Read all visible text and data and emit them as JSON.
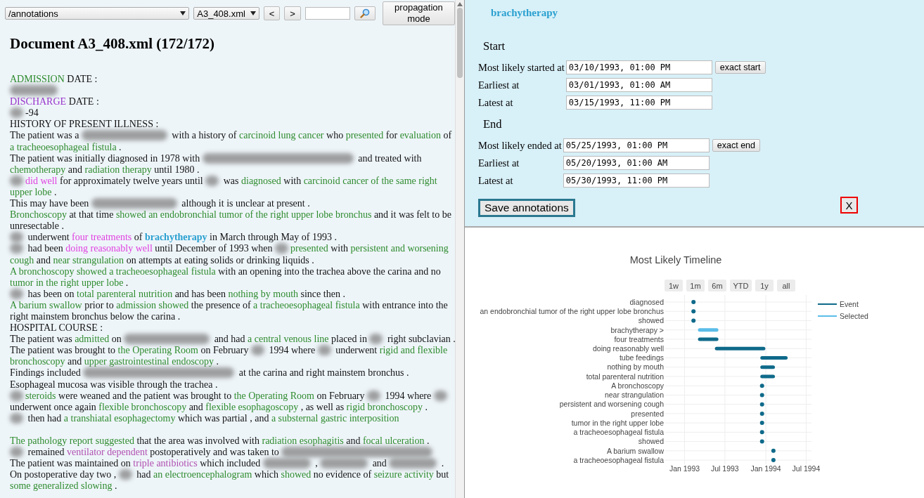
{
  "toolbar": {
    "folder": "/annotations",
    "file": "A3_408.xml",
    "prev": "<",
    "next": ">",
    "propagation": "propagation mode"
  },
  "document": {
    "title": "Document A3_408.xml (172/172)",
    "lines": [
      {
        "kind": "line",
        "segments": [
          {
            "kind": "event",
            "text": "ADMISSION"
          },
          {
            "kind": "plain",
            "text": " DATE :"
          }
        ]
      },
      {
        "kind": "line",
        "segments": [
          {
            "kind": "blurmid"
          }
        ]
      },
      {
        "kind": "line",
        "segments": [
          {
            "kind": "section",
            "text": "DISCHARGE"
          },
          {
            "kind": "plain",
            "text": " DATE :"
          }
        ]
      },
      {
        "kind": "line",
        "segments": [
          {
            "kind": "blurshort"
          },
          {
            "kind": "plain",
            "text": "-94"
          }
        ]
      },
      {
        "kind": "line",
        "segments": [
          {
            "kind": "plain",
            "text": "HISTORY OF PRESENT ILLNESS :"
          }
        ]
      },
      {
        "kind": "line",
        "segments": [
          {
            "kind": "plain",
            "text": "The patient was a "
          },
          {
            "kind": "blurlong"
          },
          {
            "kind": "plain",
            "text": " with a history of "
          },
          {
            "kind": "event",
            "text": "carcinoid lung cancer"
          },
          {
            "kind": "plain",
            "text": " who "
          },
          {
            "kind": "event",
            "text": "presented"
          },
          {
            "kind": "plain",
            "text": " for "
          },
          {
            "kind": "event",
            "text": "evaluation"
          },
          {
            "kind": "plain",
            "text": " of "
          },
          {
            "kind": "event",
            "text": "a tracheoesophageal fistula"
          },
          {
            "kind": "plain",
            "text": " ."
          }
        ]
      },
      {
        "kind": "line",
        "segments": [
          {
            "kind": "plain",
            "text": "The patient was initially diagnosed in 1978 with "
          },
          {
            "kind": "blurwide"
          },
          {
            "kind": "plain",
            "text": " and treated with "
          },
          {
            "kind": "event",
            "text": "chemotherapy"
          },
          {
            "kind": "plain",
            "text": " and "
          },
          {
            "kind": "event",
            "text": "radiation therapy"
          },
          {
            "kind": "plain",
            "text": " until 1980 ."
          }
        ]
      },
      {
        "kind": "line",
        "segments": [
          {
            "kind": "blurshort"
          },
          {
            "kind": "timex",
            "text": "did well"
          },
          {
            "kind": "plain",
            "text": " for approximately twelve years until "
          },
          {
            "kind": "blurshort"
          },
          {
            "kind": "plain",
            "text": " was "
          },
          {
            "kind": "event",
            "text": "diagnosed"
          },
          {
            "kind": "plain",
            "text": " with "
          },
          {
            "kind": "event",
            "text": "carcinoid cancer of the same right upper lobe"
          },
          {
            "kind": "plain",
            "text": " ."
          }
        ]
      },
      {
        "kind": "line",
        "segments": [
          {
            "kind": "plain",
            "text": "This may have been "
          },
          {
            "kind": "blurlong"
          },
          {
            "kind": "plain",
            "text": " although it is unclear at present ."
          }
        ]
      },
      {
        "kind": "line",
        "segments": [
          {
            "kind": "event",
            "text": "Bronchoscopy"
          },
          {
            "kind": "plain",
            "text": " at that time "
          },
          {
            "kind": "event",
            "text": "showed an endobronchial tumor of the right upper lobe bronchus"
          },
          {
            "kind": "plain",
            "text": " and it was felt to be unresectable ."
          }
        ]
      },
      {
        "kind": "line",
        "segments": [
          {
            "kind": "blurshort"
          },
          {
            "kind": "plain",
            "text": " underwent "
          },
          {
            "kind": "timex",
            "text": "four treatments"
          },
          {
            "kind": "plain",
            "text": " of "
          },
          {
            "kind": "selected",
            "text": "brachytherapy"
          },
          {
            "kind": "plain",
            "text": " in March through May of 1993 ."
          }
        ]
      },
      {
        "kind": "line",
        "segments": [
          {
            "kind": "blurshort"
          },
          {
            "kind": "plain",
            "text": " had been "
          },
          {
            "kind": "timex",
            "text": "doing reasonably well"
          },
          {
            "kind": "plain",
            "text": " until December of 1993 when "
          },
          {
            "kind": "blurshort"
          },
          {
            "kind": "event",
            "text": "presented"
          },
          {
            "kind": "plain",
            "text": " with "
          },
          {
            "kind": "event",
            "text": "persistent and worsening cough"
          },
          {
            "kind": "plain",
            "text": " and "
          },
          {
            "kind": "event",
            "text": "near strangulation"
          },
          {
            "kind": "plain",
            "text": " on attempts at eating solids or drinking liquids ."
          }
        ]
      },
      {
        "kind": "line",
        "segments": [
          {
            "kind": "event",
            "text": "A bronchoscopy showed a tracheoesophageal fistula"
          },
          {
            "kind": "plain",
            "text": " with an opening into the trachea above the carina and no "
          },
          {
            "kind": "event",
            "text": "tumor in the right upper lobe"
          },
          {
            "kind": "plain",
            "text": " ."
          }
        ]
      },
      {
        "kind": "line",
        "segments": [
          {
            "kind": "blurshort"
          },
          {
            "kind": "plain",
            "text": " has been on "
          },
          {
            "kind": "event",
            "text": "total parenteral nutrition"
          },
          {
            "kind": "plain",
            "text": " and has been "
          },
          {
            "kind": "event",
            "text": "nothing by mouth"
          },
          {
            "kind": "plain",
            "text": " since then ."
          }
        ]
      },
      {
        "kind": "line",
        "segments": [
          {
            "kind": "event",
            "text": "A barium swallow"
          },
          {
            "kind": "plain",
            "text": " prior to "
          },
          {
            "kind": "event",
            "text": "admission showed"
          },
          {
            "kind": "plain",
            "text": " the presence of "
          },
          {
            "kind": "event",
            "text": "a tracheoesophageal fistula"
          },
          {
            "kind": "plain",
            "text": " with entrance into the right mainstem bronchus below the carina ."
          }
        ]
      },
      {
        "kind": "line",
        "segments": [
          {
            "kind": "plain",
            "text": "HOSPITAL COURSE :"
          }
        ]
      },
      {
        "kind": "line",
        "segments": [
          {
            "kind": "plain",
            "text": "The patient was "
          },
          {
            "kind": "event",
            "text": "admitted"
          },
          {
            "kind": "plain",
            "text": " on "
          },
          {
            "kind": "blurlong"
          },
          {
            "kind": "plain",
            "text": " and had "
          },
          {
            "kind": "event",
            "text": "a central venous line"
          },
          {
            "kind": "plain",
            "text": " placed in "
          },
          {
            "kind": "blurshort"
          },
          {
            "kind": "plain",
            "text": " right subclavian ."
          }
        ]
      },
      {
        "kind": "line",
        "segments": [
          {
            "kind": "plain",
            "text": "The patient was brought to "
          },
          {
            "kind": "event",
            "text": "the Operating Room"
          },
          {
            "kind": "plain",
            "text": " on February "
          },
          {
            "kind": "blurshort"
          },
          {
            "kind": "plain",
            "text": " 1994 where "
          },
          {
            "kind": "blurshort"
          },
          {
            "kind": "plain",
            "text": " underwent "
          },
          {
            "kind": "event",
            "text": "rigid and flexible bronchoscopy"
          },
          {
            "kind": "plain",
            "text": " and "
          },
          {
            "kind": "event",
            "text": "upper gastrointestinal endoscopy"
          },
          {
            "kind": "plain",
            "text": " ."
          }
        ]
      },
      {
        "kind": "line",
        "segments": [
          {
            "kind": "plain",
            "text": "Findings included "
          },
          {
            "kind": "blurwide"
          },
          {
            "kind": "plain",
            "text": " at the carina and right mainstem bronchus ."
          }
        ]
      },
      {
        "kind": "line",
        "segments": [
          {
            "kind": "plain",
            "text": "Esophageal mucosa was visible through the trachea ."
          }
        ]
      },
      {
        "kind": "line",
        "segments": [
          {
            "kind": "blurshort"
          },
          {
            "kind": "event",
            "text": "steroids"
          },
          {
            "kind": "plain",
            "text": " were weaned and the patient was brought to "
          },
          {
            "kind": "event",
            "text": "the Operating Room"
          },
          {
            "kind": "plain",
            "text": " on February "
          },
          {
            "kind": "blurshort"
          },
          {
            "kind": "plain",
            "text": " 1994 where "
          },
          {
            "kind": "blurshort"
          },
          {
            "kind": "plain",
            "text": " underwent once again "
          },
          {
            "kind": "event",
            "text": "flexible bronchoscopy"
          },
          {
            "kind": "plain",
            "text": " and "
          },
          {
            "kind": "event",
            "text": "flexible esophagoscopy"
          },
          {
            "kind": "plain",
            "text": " , as well as "
          },
          {
            "kind": "event",
            "text": "rigid bronchoscopy"
          },
          {
            "kind": "plain",
            "text": " ."
          }
        ]
      },
      {
        "kind": "line",
        "segments": [
          {
            "kind": "blurshort"
          },
          {
            "kind": "plain",
            "text": " then had "
          },
          {
            "kind": "event",
            "text": "a transhiatal esophagectomy"
          },
          {
            "kind": "plain",
            "text": " which was partial , and "
          },
          {
            "kind": "event",
            "text": "a substernal gastric interposition"
          }
        ]
      },
      {
        "kind": "break"
      },
      {
        "kind": "line",
        "segments": [
          {
            "kind": "event",
            "text": "The pathology report suggested"
          },
          {
            "kind": "plain",
            "text": " that the area was involved with "
          },
          {
            "kind": "event",
            "text": "radiation esophagitis"
          },
          {
            "kind": "plain",
            "text": " and "
          },
          {
            "kind": "event",
            "text": "focal ulceration"
          },
          {
            "kind": "plain",
            "text": " ."
          }
        ]
      },
      {
        "kind": "line",
        "segments": [
          {
            "kind": "blurshort"
          },
          {
            "kind": "plain",
            "text": " remained "
          },
          {
            "kind": "modifier",
            "text": "ventilator dependent"
          },
          {
            "kind": "plain",
            "text": " postoperatively and was taken to "
          },
          {
            "kind": "blurwide"
          }
        ]
      },
      {
        "kind": "line",
        "segments": [
          {
            "kind": "plain",
            "text": "The patient was maintained on "
          },
          {
            "kind": "modifier",
            "text": "triple antibiotics"
          },
          {
            "kind": "plain",
            "text": " which included "
          },
          {
            "kind": "blurmid"
          },
          {
            "kind": "plain",
            "text": " , "
          },
          {
            "kind": "blurmid"
          },
          {
            "kind": "plain",
            "text": " and "
          },
          {
            "kind": "blurmid"
          },
          {
            "kind": "plain",
            "text": " ."
          }
        ]
      },
      {
        "kind": "line",
        "segments": [
          {
            "kind": "plain",
            "text": "On postoperative day two , "
          },
          {
            "kind": "blurshort"
          },
          {
            "kind": "plain",
            "text": " had "
          },
          {
            "kind": "event",
            "text": "an electroencephalogram"
          },
          {
            "kind": "plain",
            "text": " which "
          },
          {
            "kind": "event",
            "text": "showed"
          },
          {
            "kind": "plain",
            "text": " no evidence of "
          },
          {
            "kind": "event",
            "text": "seizure activity"
          },
          {
            "kind": "plain",
            "text": " but "
          },
          {
            "kind": "event",
            "text": "some generalized slowing"
          },
          {
            "kind": "plain",
            "text": " ."
          }
        ]
      }
    ]
  },
  "annotation": {
    "title": "brachytherapy",
    "sections": [
      {
        "heading": "Start",
        "rows": [
          {
            "label": "Most likely started at",
            "value": "03/10/1993, 01:00 PM",
            "button": "exact start"
          },
          {
            "label": "Earliest at",
            "value": "03/01/1993, 01:00 AM"
          },
          {
            "label": "Latest at",
            "value": "03/15/1993, 11:00 PM"
          }
        ]
      },
      {
        "heading": "End",
        "rows": [
          {
            "label": "Most likely ended at",
            "value": "05/25/1993, 01:00 PM",
            "button": "exact end"
          },
          {
            "label": "Earliest at",
            "value": "05/20/1993, 01:00 AM"
          },
          {
            "label": "Latest at",
            "value": "05/30/1993, 11:00 PM"
          }
        ]
      }
    ],
    "save": "Save annotations",
    "close": "X"
  },
  "timeline": {
    "title": "Most Likely Timeline",
    "range_buttons": [
      "1w",
      "1m",
      "6m",
      "YTD",
      "1y",
      "all"
    ],
    "rows": [
      {
        "label": "diagnosed",
        "selected": false
      },
      {
        "label": "an endobronchial tumor of the right upper lobe bronchus",
        "selected": false
      },
      {
        "label": "showed",
        "selected": false
      },
      {
        "label": "brachytherapy >",
        "selected": true
      },
      {
        "label": "four treatments",
        "selected": false
      },
      {
        "label": "doing reasonably well",
        "selected": false
      },
      {
        "label": "tube feedings",
        "selected": false
      },
      {
        "label": "nothing by mouth",
        "selected": false
      },
      {
        "label": "total parenteral nutrition",
        "selected": false
      },
      {
        "label": "A bronchoscopy",
        "selected": false
      },
      {
        "label": "near strangulation",
        "selected": false
      },
      {
        "label": "persistent and worsening cough",
        "selected": false
      },
      {
        "label": "presented",
        "selected": false
      },
      {
        "label": "tumor in the right upper lobe",
        "selected": false
      },
      {
        "label": "a tracheoesophageal fistula",
        "selected": false
      },
      {
        "label": "showed",
        "selected": false
      },
      {
        "label": "A barium swallow",
        "selected": false
      },
      {
        "label": "a tracheoesophageal fistula",
        "selected": false
      }
    ],
    "axis_labels": [
      "Jan 1993",
      "Jul 1993",
      "Jan 1994",
      "Jul 1994"
    ],
    "legend": [
      {
        "name": "Event",
        "color": "#0f6a8a"
      },
      {
        "name": "Selected",
        "color": "#5bbde8"
      }
    ]
  }
}
